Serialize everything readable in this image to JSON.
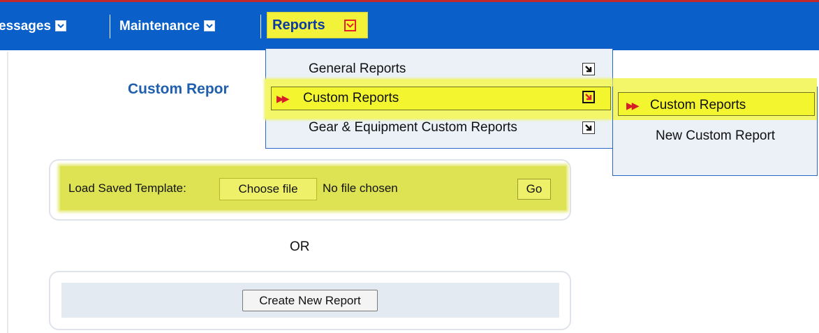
{
  "nav": {
    "items": [
      {
        "label": "essages"
      },
      {
        "label": "Maintenance"
      },
      {
        "label": "Reports"
      }
    ]
  },
  "page": {
    "title": "Custom Repor"
  },
  "load_template": {
    "label": "Load Saved Template:",
    "choose_button": "Choose file",
    "file_status": "No file chosen",
    "go_button": "Go"
  },
  "separator_text": "OR",
  "create_button": "Create New Report",
  "reports_menu": {
    "items": [
      {
        "label": "General Reports"
      },
      {
        "label": "Custom Reports"
      },
      {
        "label": "Gear & Equipment Custom Reports"
      }
    ]
  },
  "custom_submenu": {
    "items": [
      {
        "label": "Custom Reports"
      },
      {
        "label": "New Custom Report"
      }
    ]
  },
  "colors": {
    "nav_blue": "#0b5fc9",
    "highlight_yellow": "#f3f52f",
    "title_blue": "#1f5fae",
    "arrow_red": "#d71d25"
  },
  "icons": [
    "chevron-down-icon",
    "submenu-arrow-icon",
    "double-arrow-icon"
  ]
}
